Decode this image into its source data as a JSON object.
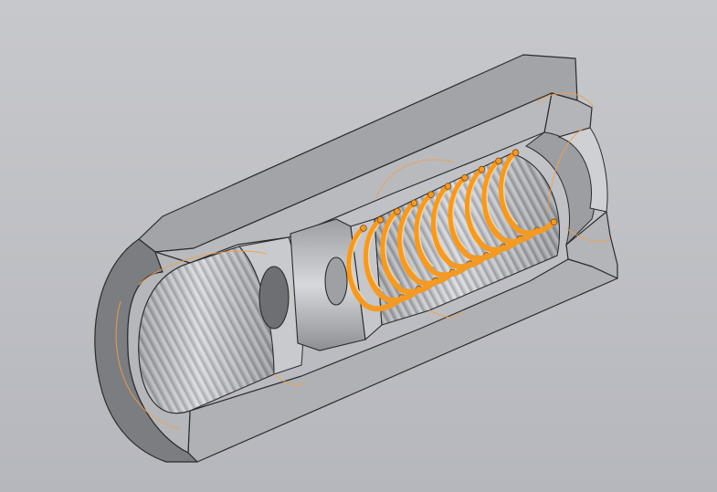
{
  "scene": {
    "view": "isometric",
    "mode": "section-cut",
    "background_color": "#c2c3c8",
    "part_color": "#a6a7ab",
    "section_color": "#b9babd",
    "edge_color": "#2b2b2d",
    "spring_color": "#f39a25",
    "guideline_color": "#f0a050"
  },
  "model": {
    "components": [
      {
        "id": "housing",
        "kind": "threaded-bore-housing"
      },
      {
        "id": "plunger",
        "kind": "stepped-plunger"
      },
      {
        "id": "spring",
        "kind": "helical-coil-spring",
        "visible_coils": 10
      }
    ]
  }
}
